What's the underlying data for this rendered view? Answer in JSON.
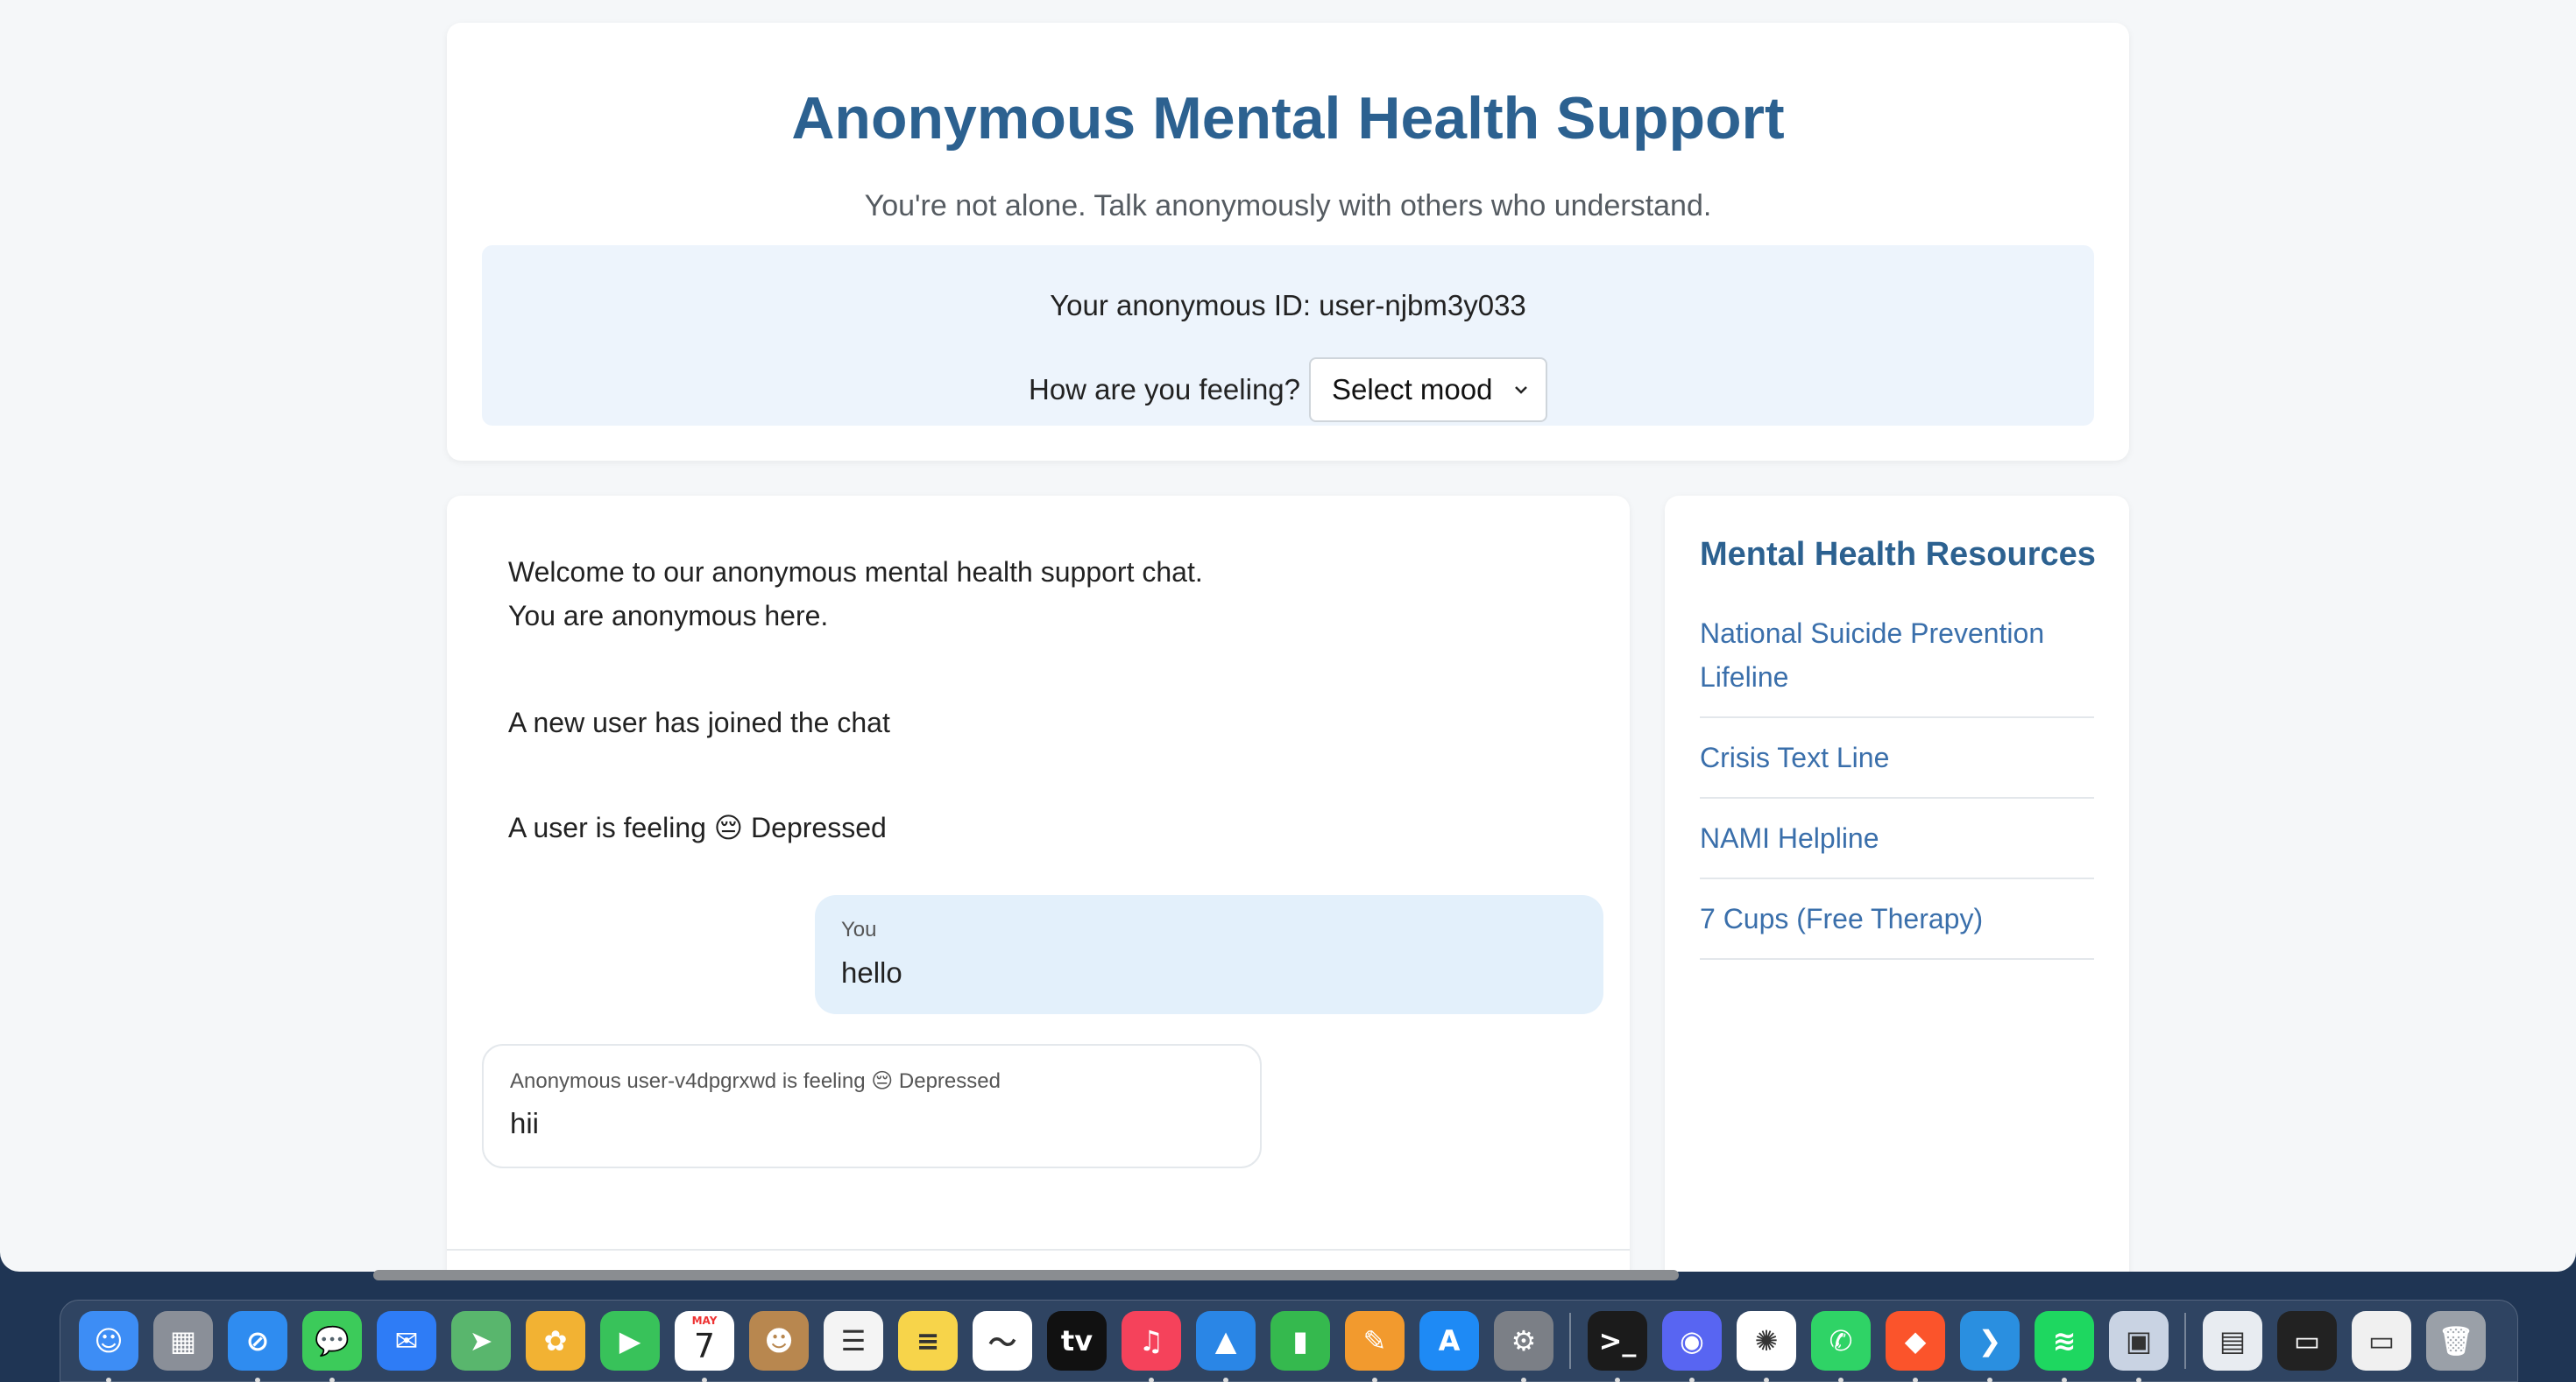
{
  "header": {
    "title": "Anonymous Mental Health Support",
    "subtitle": "You're not alone. Talk anonymously with others who understand.",
    "anonymous_id": "Your anonymous ID: user-njbm3y033",
    "mood_label": "How are you feeling?",
    "mood_select_value": "Select mood"
  },
  "chat": {
    "system_messages": [
      "Welcome to our anonymous mental health support chat.",
      "You are anonymous here.",
      "A new user has joined the chat",
      "A user is feeling 😔 Depressed"
    ],
    "messages": [
      {
        "sender": "You",
        "text": "hello"
      },
      {
        "sender": "Anonymous user-v4dpgrxwd is feeling 😔 Depressed",
        "text": "hii"
      }
    ]
  },
  "resources": {
    "title": "Mental Health Resources",
    "links": [
      "National Suicide Prevention Lifeline",
      "Crisis Text Line",
      "NAMI Helpline",
      "7 Cups (Free Therapy)"
    ]
  },
  "dock": {
    "calendar_month": "MAY",
    "calendar_day": "7",
    "apps": [
      {
        "name": "finder-icon",
        "color": "#3d8df5"
      },
      {
        "name": "launchpad-icon",
        "color": "#8a8f98"
      },
      {
        "name": "safari-icon",
        "color": "#2f8cf0"
      },
      {
        "name": "messages-icon",
        "color": "#3ccb5a"
      },
      {
        "name": "mail-icon",
        "color": "#2e7cf6"
      },
      {
        "name": "maps-icon",
        "color": "#59b66d"
      },
      {
        "name": "photos-icon",
        "color": "#f2b233"
      },
      {
        "name": "facetime-icon",
        "color": "#38c25a"
      },
      {
        "name": "calendar-icon",
        "color": "#ffffff"
      },
      {
        "name": "contacts-icon",
        "color": "#b8874f"
      },
      {
        "name": "reminders-icon",
        "color": "#f4f4f4"
      },
      {
        "name": "notes-icon",
        "color": "#f7d44a"
      },
      {
        "name": "freeform-icon",
        "color": "#ffffff"
      },
      {
        "name": "appletv-icon",
        "color": "#111111"
      },
      {
        "name": "music-icon",
        "color": "#f5425b"
      },
      {
        "name": "keynote-icon",
        "color": "#2a86e6"
      },
      {
        "name": "numbers-icon",
        "color": "#35b94e"
      },
      {
        "name": "pages-icon",
        "color": "#f29a2e"
      },
      {
        "name": "appstore-icon",
        "color": "#1e8af5"
      },
      {
        "name": "system-settings-icon",
        "color": "#7b7f86"
      },
      {
        "name": "terminal-icon",
        "color": "#1b1b1b"
      },
      {
        "name": "discord-icon",
        "color": "#5865f2"
      },
      {
        "name": "chatgpt-icon",
        "color": "#ffffff"
      },
      {
        "name": "whatsapp-icon",
        "color": "#2fd366"
      },
      {
        "name": "brave-icon",
        "color": "#fb542b"
      },
      {
        "name": "vscode-icon",
        "color": "#2a8fe0"
      },
      {
        "name": "spotify-icon",
        "color": "#1ed760"
      },
      {
        "name": "preview-icon",
        "color": "#c9d3e3"
      },
      {
        "name": "document-icon",
        "color": "#e8ecf1"
      },
      {
        "name": "window-thumbnail-icon",
        "color": "#222222"
      },
      {
        "name": "window-thumbnail-2-icon",
        "color": "#f0f0f0"
      },
      {
        "name": "trash-icon",
        "color": "#9aa0a8"
      }
    ]
  }
}
